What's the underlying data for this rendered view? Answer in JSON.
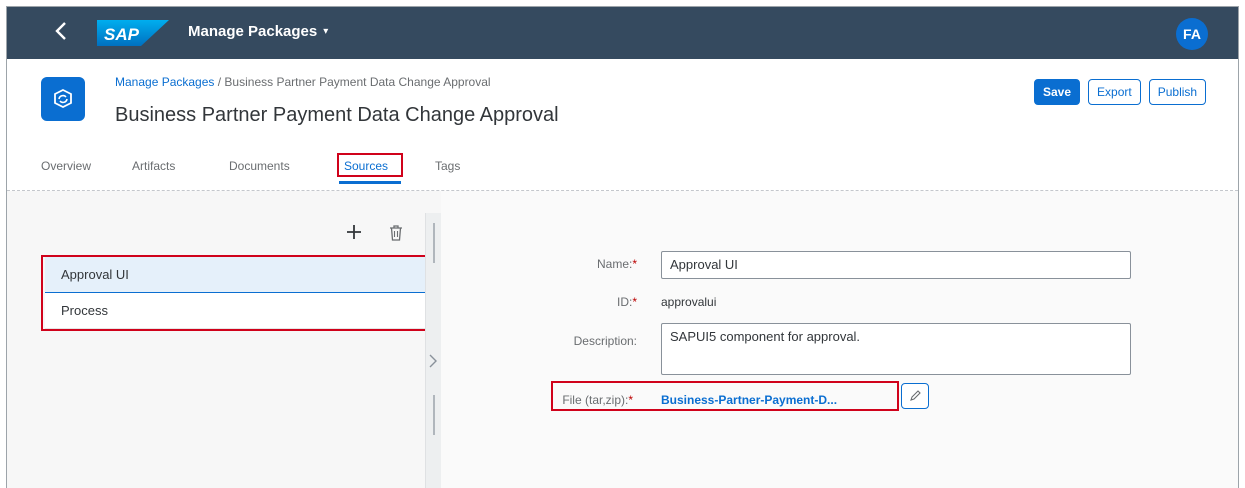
{
  "shell": {
    "back_icon": "chevron-left-icon",
    "logo_text": "SAP",
    "app_title": "Manage Packages",
    "app_title_caret": "▾",
    "avatar_initials": "FA"
  },
  "header": {
    "breadcrumb_link": "Manage Packages",
    "breadcrumb_separator": " / ",
    "breadcrumb_current": "Business Partner Payment Data Change Approval",
    "title": "Business Partner Payment Data Change Approval",
    "buttons": {
      "save": "Save",
      "export": "Export",
      "publish": "Publish"
    }
  },
  "tabs": [
    {
      "label": "Overview"
    },
    {
      "label": "Artifacts"
    },
    {
      "label": "Documents"
    },
    {
      "label": "Sources",
      "active": true
    },
    {
      "label": "Tags"
    }
  ],
  "sources": {
    "add_icon": "add-icon",
    "delete_icon": "delete-icon",
    "items": [
      {
        "label": "Approval UI",
        "selected": true
      },
      {
        "label": "Process"
      }
    ]
  },
  "form": {
    "name_label": "Name:",
    "name_value": "Approval UI",
    "id_label": "ID:",
    "id_value": "approvalui",
    "description_label": "Description:",
    "description_value": "SAPUI5 component for approval.",
    "file_label": "File (tar,zip):",
    "file_value": "Business-Partner-Payment-D...",
    "required_mark": "*"
  },
  "colors": {
    "shell_bg": "#354a5f",
    "accent": "#0a6ed1",
    "highlight": "#d0021b"
  }
}
